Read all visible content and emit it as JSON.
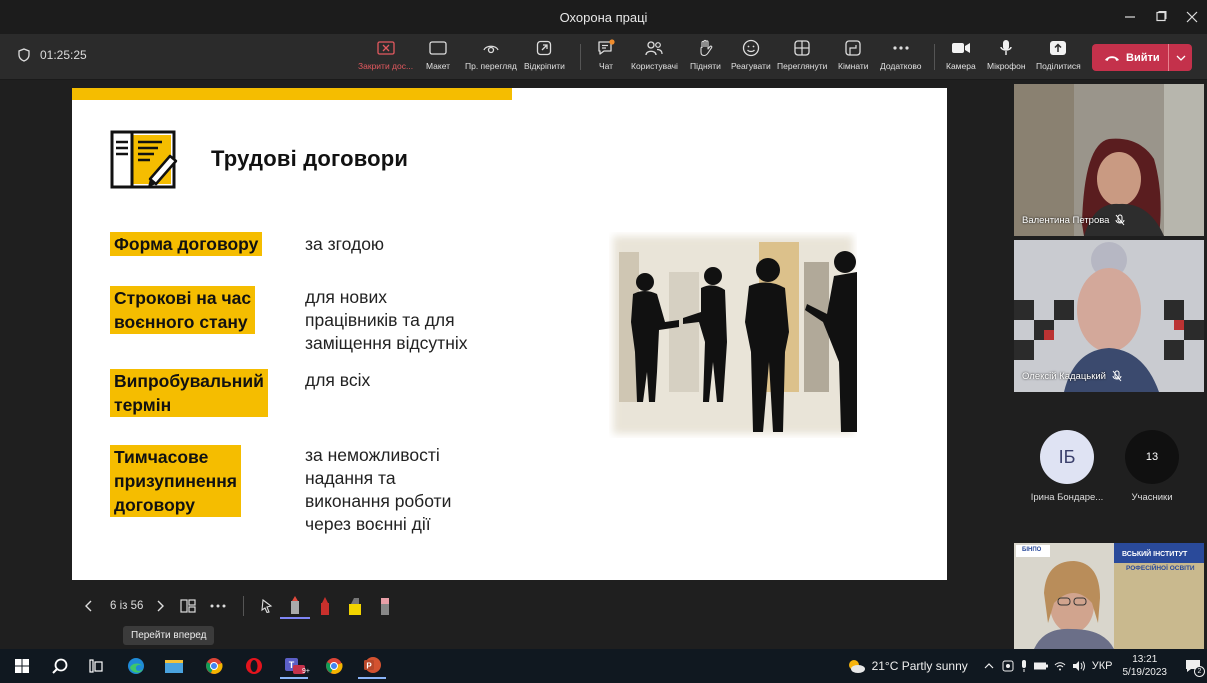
{
  "window": {
    "title": "Охорона праці"
  },
  "toolbar": {
    "timer": "01:25:25",
    "buttons": [
      {
        "id": "stop-sharing",
        "label": "Закрити дос..."
      },
      {
        "id": "layout",
        "label": "Макет"
      },
      {
        "id": "private-view",
        "label": "Пр. перегляд"
      },
      {
        "id": "popout",
        "label": "Відкріпити"
      },
      {
        "id": "chat",
        "label": "Чат"
      },
      {
        "id": "people",
        "label": "Користувачі"
      },
      {
        "id": "raise",
        "label": "Підняти"
      },
      {
        "id": "react",
        "label": "Реагувати"
      },
      {
        "id": "view",
        "label": "Переглянути"
      },
      {
        "id": "rooms",
        "label": "Кімнати"
      },
      {
        "id": "more",
        "label": "Додатково"
      },
      {
        "id": "camera",
        "label": "Камера"
      },
      {
        "id": "mic",
        "label": "Мікрофон"
      },
      {
        "id": "share",
        "label": "Поділитися"
      }
    ],
    "leave_label": "Вийти",
    "accent_red": "#c4314b"
  },
  "slide": {
    "title": "Трудові договори",
    "accent": "#f5bd00",
    "rows": [
      {
        "label": [
          "Форма договору"
        ],
        "value": [
          "за згодою"
        ]
      },
      {
        "label": [
          "Строкові на час",
          "воєнного стану"
        ],
        "value": [
          "для нових",
          "працівників та для",
          "заміщення відсутніх"
        ]
      },
      {
        "label": [
          "Випробувальний",
          "термін"
        ],
        "value": [
          "для всіх"
        ]
      },
      {
        "label": [
          "Тимчасове",
          "призупинення",
          "договору"
        ],
        "value": [
          "за неможливості",
          "надання та",
          "виконання роботи",
          "через воєнні дії"
        ]
      }
    ]
  },
  "slide_controls": {
    "counter": "6 із 56",
    "tooltip": "Перейти вперед"
  },
  "participants": {
    "video": [
      {
        "name": "Валентина Петрова"
      },
      {
        "name": "Олексій Кадацький"
      }
    ],
    "avatar": {
      "initials": "ІБ",
      "name": "Ірина Бондаре..."
    },
    "count": {
      "value": "13",
      "label": "Учасники"
    },
    "bottom_tile": {
      "logo_text": "БІНПО",
      "banner_line1": "ВСЬКИЙ ІНСТИТУТ",
      "banner_line2": "РОФЕСІЙНОЇ ОСВІТИ"
    }
  },
  "taskbar": {
    "weather": "21°C  Partly sunny",
    "lang": "УКР",
    "time": "13:21",
    "date": "5/19/2023",
    "notif_count": "2",
    "teams_badge": "9+"
  }
}
